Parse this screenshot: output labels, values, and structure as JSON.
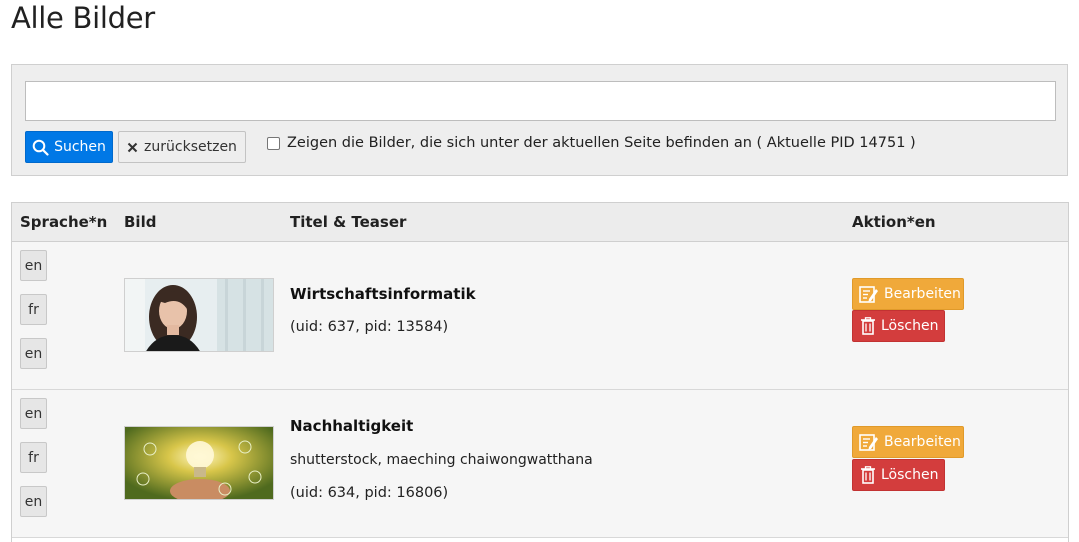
{
  "page": {
    "title": "Alle Bilder"
  },
  "search": {
    "value": "",
    "placeholder": "",
    "search_label": "Suchen",
    "reset_label": "zurücksetzen",
    "checkbox_label": "Zeigen die Bilder, die sich unter der aktuellen Seite befinden an ( Aktuelle PID 14751 )",
    "checkbox_checked": false
  },
  "table": {
    "headers": {
      "lang": "Sprache*n",
      "image": "Bild",
      "title": "Titel & Teaser",
      "actions": "Aktion*en"
    },
    "rows": [
      {
        "langs": [
          "en",
          "fr",
          "en"
        ],
        "title": "Wirtschaftsinformatik",
        "credit": "",
        "meta": "(uid: 637, pid: 13584)",
        "edit_label": "Bearbeiten",
        "delete_label": "Löschen"
      },
      {
        "langs": [
          "en",
          "fr",
          "en"
        ],
        "title": "Nachhaltigkeit",
        "credit": "shutterstock, maeching chaiwongwatthana",
        "meta": "(uid: 634, pid: 16806)",
        "edit_label": "Bearbeiten",
        "delete_label": "Löschen"
      }
    ]
  },
  "colors": {
    "primary": "#0078e6",
    "warning": "#f0a93a",
    "danger": "#d33d3d"
  },
  "icons": {
    "search": "search-icon",
    "reset": "close-icon",
    "edit": "edit-icon",
    "delete": "trash-icon"
  }
}
